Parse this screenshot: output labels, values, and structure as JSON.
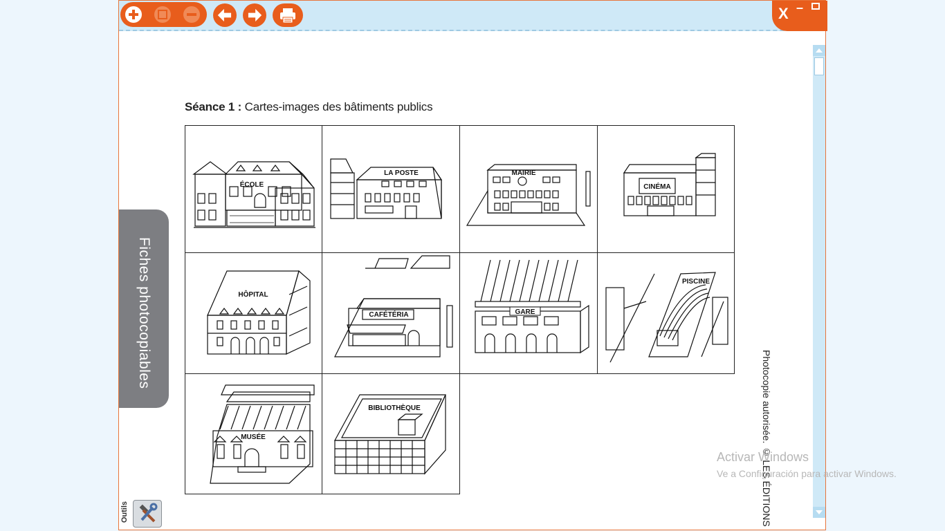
{
  "toolbar": {
    "buttons": [
      "zoom-in",
      "fit-page",
      "zoom-out",
      "previous-page",
      "next-page",
      "print"
    ]
  },
  "window": {
    "close_label": "X",
    "minimize_label": "–"
  },
  "page": {
    "heading_bold": "Séance 1 :",
    "heading_rest": " Cartes-images des bâtiments publics",
    "copyright": "Photocopie autorisée. © LES ÉDITIONS",
    "cards": [
      {
        "label": "ÉCOLE"
      },
      {
        "label": "LA POSTE"
      },
      {
        "label": "MAIRIE"
      },
      {
        "label": "CINÉMA"
      },
      {
        "label": "HÔPITAL"
      },
      {
        "label": "CAFÉTÉRIA"
      },
      {
        "label": "GARE"
      },
      {
        "label": "PISCINE"
      },
      {
        "label": "MUSÉE"
      },
      {
        "label": "BIBLIOTHÈQUE"
      }
    ]
  },
  "side_tab": {
    "label": "Fiches photocopiables"
  },
  "tools": {
    "label": "Outils"
  },
  "os_watermark": {
    "title": "Activar Windows",
    "subtitle": "Ve a Configuración para activar Windows."
  },
  "colors": {
    "accent": "#e85d1c",
    "toolbar_bg": "#cfe9f7",
    "side_tab": "#7d7e82"
  }
}
